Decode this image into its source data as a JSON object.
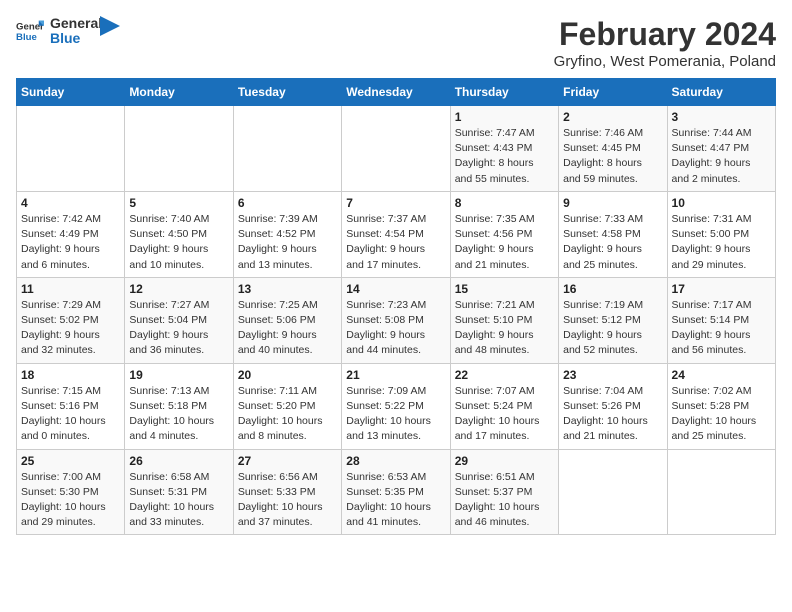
{
  "header": {
    "logo_line1": "General",
    "logo_line2": "Blue",
    "title": "February 2024",
    "subtitle": "Gryfino, West Pomerania, Poland"
  },
  "columns": [
    "Sunday",
    "Monday",
    "Tuesday",
    "Wednesday",
    "Thursday",
    "Friday",
    "Saturday"
  ],
  "weeks": [
    {
      "days": [
        {
          "num": "",
          "detail": ""
        },
        {
          "num": "",
          "detail": ""
        },
        {
          "num": "",
          "detail": ""
        },
        {
          "num": "",
          "detail": ""
        },
        {
          "num": "1",
          "detail": "Sunrise: 7:47 AM\nSunset: 4:43 PM\nDaylight: 8 hours\nand 55 minutes."
        },
        {
          "num": "2",
          "detail": "Sunrise: 7:46 AM\nSunset: 4:45 PM\nDaylight: 8 hours\nand 59 minutes."
        },
        {
          "num": "3",
          "detail": "Sunrise: 7:44 AM\nSunset: 4:47 PM\nDaylight: 9 hours\nand 2 minutes."
        }
      ]
    },
    {
      "days": [
        {
          "num": "4",
          "detail": "Sunrise: 7:42 AM\nSunset: 4:49 PM\nDaylight: 9 hours\nand 6 minutes."
        },
        {
          "num": "5",
          "detail": "Sunrise: 7:40 AM\nSunset: 4:50 PM\nDaylight: 9 hours\nand 10 minutes."
        },
        {
          "num": "6",
          "detail": "Sunrise: 7:39 AM\nSunset: 4:52 PM\nDaylight: 9 hours\nand 13 minutes."
        },
        {
          "num": "7",
          "detail": "Sunrise: 7:37 AM\nSunset: 4:54 PM\nDaylight: 9 hours\nand 17 minutes."
        },
        {
          "num": "8",
          "detail": "Sunrise: 7:35 AM\nSunset: 4:56 PM\nDaylight: 9 hours\nand 21 minutes."
        },
        {
          "num": "9",
          "detail": "Sunrise: 7:33 AM\nSunset: 4:58 PM\nDaylight: 9 hours\nand 25 minutes."
        },
        {
          "num": "10",
          "detail": "Sunrise: 7:31 AM\nSunset: 5:00 PM\nDaylight: 9 hours\nand 29 minutes."
        }
      ]
    },
    {
      "days": [
        {
          "num": "11",
          "detail": "Sunrise: 7:29 AM\nSunset: 5:02 PM\nDaylight: 9 hours\nand 32 minutes."
        },
        {
          "num": "12",
          "detail": "Sunrise: 7:27 AM\nSunset: 5:04 PM\nDaylight: 9 hours\nand 36 minutes."
        },
        {
          "num": "13",
          "detail": "Sunrise: 7:25 AM\nSunset: 5:06 PM\nDaylight: 9 hours\nand 40 minutes."
        },
        {
          "num": "14",
          "detail": "Sunrise: 7:23 AM\nSunset: 5:08 PM\nDaylight: 9 hours\nand 44 minutes."
        },
        {
          "num": "15",
          "detail": "Sunrise: 7:21 AM\nSunset: 5:10 PM\nDaylight: 9 hours\nand 48 minutes."
        },
        {
          "num": "16",
          "detail": "Sunrise: 7:19 AM\nSunset: 5:12 PM\nDaylight: 9 hours\nand 52 minutes."
        },
        {
          "num": "17",
          "detail": "Sunrise: 7:17 AM\nSunset: 5:14 PM\nDaylight: 9 hours\nand 56 minutes."
        }
      ]
    },
    {
      "days": [
        {
          "num": "18",
          "detail": "Sunrise: 7:15 AM\nSunset: 5:16 PM\nDaylight: 10 hours\nand 0 minutes."
        },
        {
          "num": "19",
          "detail": "Sunrise: 7:13 AM\nSunset: 5:18 PM\nDaylight: 10 hours\nand 4 minutes."
        },
        {
          "num": "20",
          "detail": "Sunrise: 7:11 AM\nSunset: 5:20 PM\nDaylight: 10 hours\nand 8 minutes."
        },
        {
          "num": "21",
          "detail": "Sunrise: 7:09 AM\nSunset: 5:22 PM\nDaylight: 10 hours\nand 13 minutes."
        },
        {
          "num": "22",
          "detail": "Sunrise: 7:07 AM\nSunset: 5:24 PM\nDaylight: 10 hours\nand 17 minutes."
        },
        {
          "num": "23",
          "detail": "Sunrise: 7:04 AM\nSunset: 5:26 PM\nDaylight: 10 hours\nand 21 minutes."
        },
        {
          "num": "24",
          "detail": "Sunrise: 7:02 AM\nSunset: 5:28 PM\nDaylight: 10 hours\nand 25 minutes."
        }
      ]
    },
    {
      "days": [
        {
          "num": "25",
          "detail": "Sunrise: 7:00 AM\nSunset: 5:30 PM\nDaylight: 10 hours\nand 29 minutes."
        },
        {
          "num": "26",
          "detail": "Sunrise: 6:58 AM\nSunset: 5:31 PM\nDaylight: 10 hours\nand 33 minutes."
        },
        {
          "num": "27",
          "detail": "Sunrise: 6:56 AM\nSunset: 5:33 PM\nDaylight: 10 hours\nand 37 minutes."
        },
        {
          "num": "28",
          "detail": "Sunrise: 6:53 AM\nSunset: 5:35 PM\nDaylight: 10 hours\nand 41 minutes."
        },
        {
          "num": "29",
          "detail": "Sunrise: 6:51 AM\nSunset: 5:37 PM\nDaylight: 10 hours\nand 46 minutes."
        },
        {
          "num": "",
          "detail": ""
        },
        {
          "num": "",
          "detail": ""
        }
      ]
    }
  ]
}
